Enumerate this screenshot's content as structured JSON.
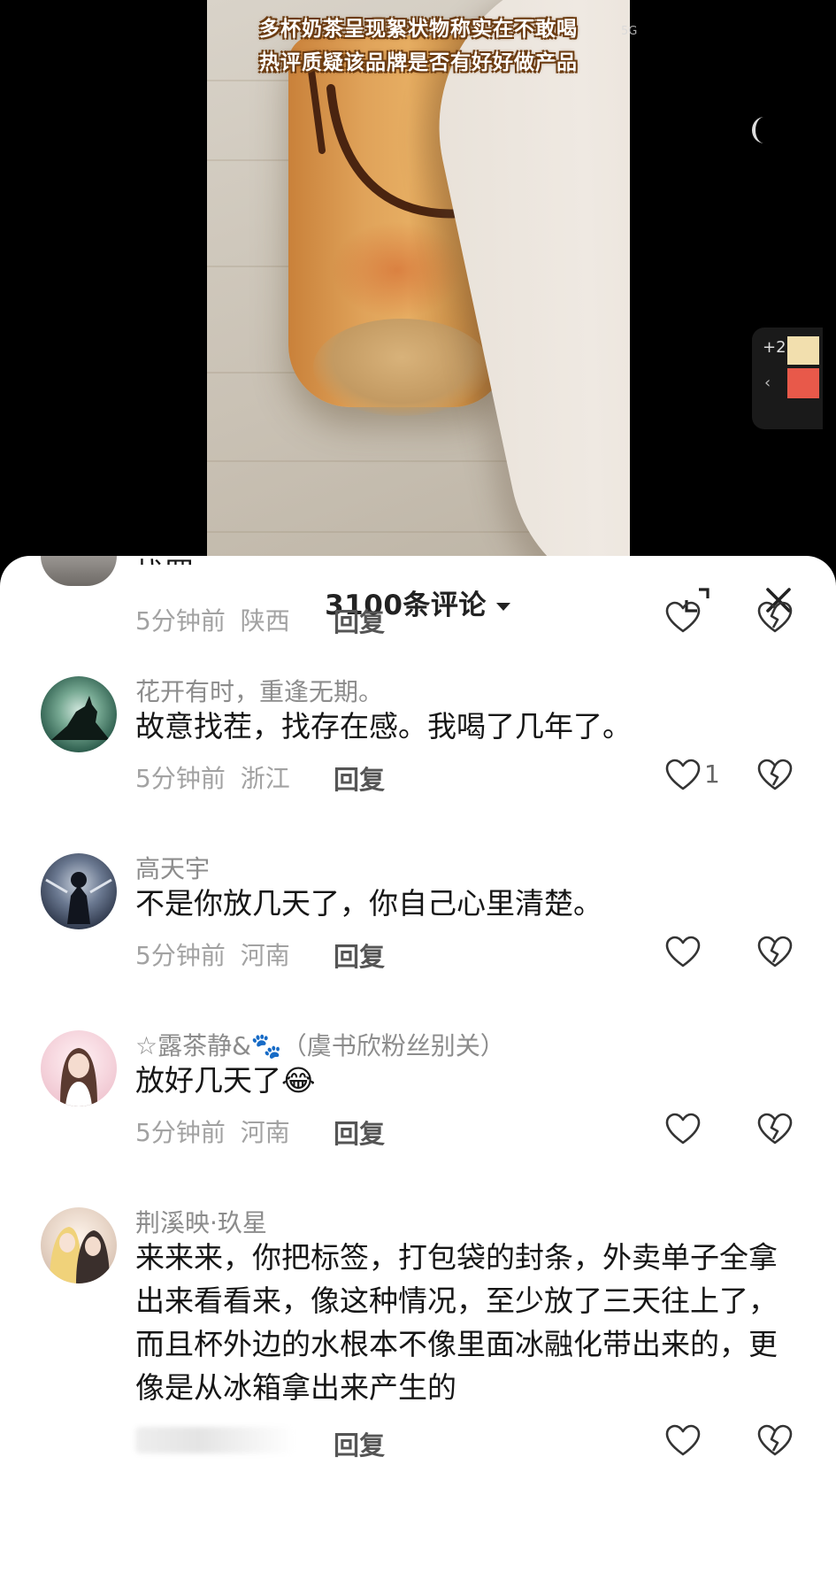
{
  "video": {
    "caption_line1": "多杯奶茶呈现絮状物称实在不敢喝",
    "caption_line2": "热评质疑该品牌是否有好好做产品",
    "signal_badge": "5G",
    "side_badge": "+2"
  },
  "comments_header": {
    "count_label": "3100条评论",
    "icons": [
      "caret-down-icon",
      "expand-icon",
      "close-icon"
    ]
  },
  "comments": [
    {
      "text": "找罪",
      "time": "5分钟前",
      "location": "陕西",
      "reply_label": "回复"
    },
    {
      "username": "花开有时，重逢无期。",
      "text": "故意找茬，找存在感。我喝了几年了。",
      "time": "5分钟前",
      "location": "浙江",
      "reply_label": "回复",
      "likes": "1"
    },
    {
      "username": "高天宇",
      "text": "不是你放几天了，你自己心里清楚。",
      "time": "5分钟前",
      "location": "河南",
      "reply_label": "回复"
    },
    {
      "username": "☆露茶静&🐾（虞书欣粉丝别关）",
      "text": "放好几天了😂",
      "time": "5分钟前",
      "location": "河南",
      "reply_label": "回复"
    },
    {
      "username": "荆溪映·玖星",
      "text": "来来来，你把标签，打包袋的封条，外卖单子全拿出来看看来，像这种情况，至少放了三天往上了，而且杯外边的水根本不像里面冰融化带出来的，更像是从冰箱拿出来产生的",
      "reply_label": "回复"
    }
  ],
  "colors": {
    "sheet_background": "#ffffff",
    "video_background": "#000000",
    "caption_outline": "#6b3b10",
    "username_gray": "#8c8c8c",
    "meta_gray": "#a2a2a2"
  }
}
